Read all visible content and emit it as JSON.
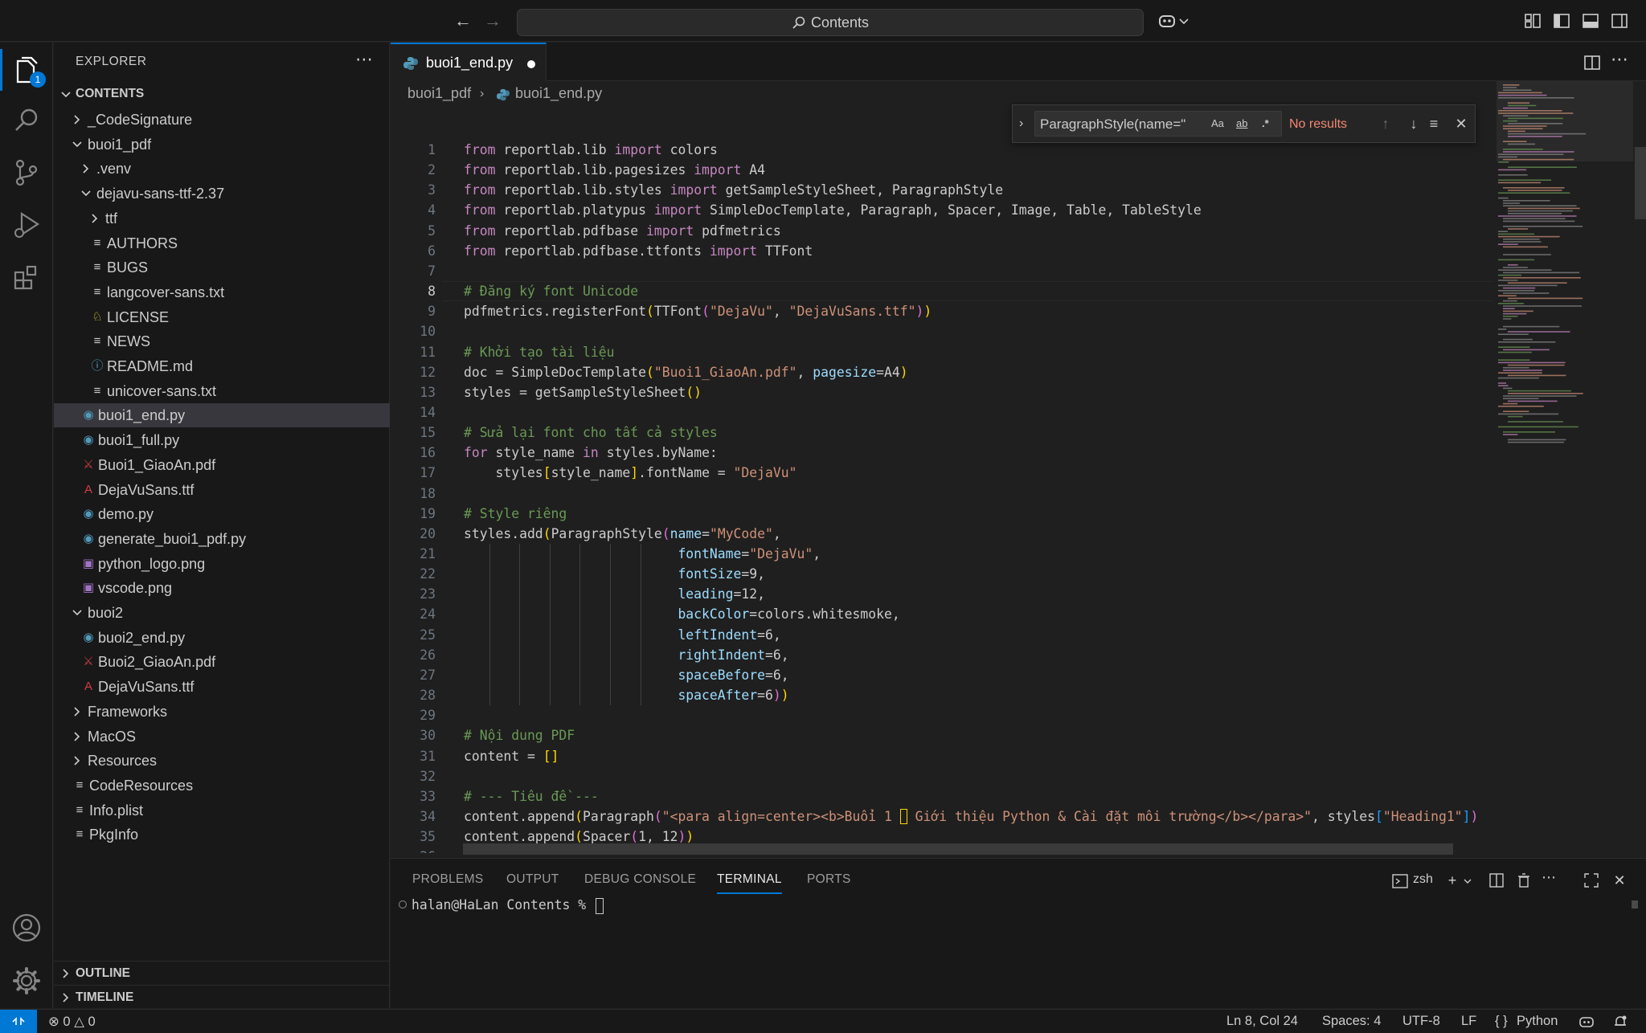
{
  "titlebar": {
    "search_text": "Contents"
  },
  "activity": {
    "explorer_badge": "1"
  },
  "sidebar": {
    "title": "EXPLORER",
    "section": "CONTENTS",
    "tree": [
      {
        "label": "_CodeSignature",
        "depth": 0,
        "type": "folder",
        "open": false
      },
      {
        "label": "buoi1_pdf",
        "depth": 0,
        "type": "folder",
        "open": true
      },
      {
        "label": ".venv",
        "depth": 1,
        "type": "folder",
        "open": false
      },
      {
        "label": "dejavu-sans-ttf-2.37",
        "depth": 1,
        "type": "folder",
        "open": true
      },
      {
        "label": "ttf",
        "depth": 2,
        "type": "folder",
        "open": false
      },
      {
        "label": "AUTHORS",
        "depth": 2,
        "type": "text"
      },
      {
        "label": "BUGS",
        "depth": 2,
        "type": "text"
      },
      {
        "label": "langcover-sans.txt",
        "depth": 2,
        "type": "text"
      },
      {
        "label": "LICENSE",
        "depth": 2,
        "type": "license"
      },
      {
        "label": "NEWS",
        "depth": 2,
        "type": "text"
      },
      {
        "label": "README.md",
        "depth": 2,
        "type": "info"
      },
      {
        "label": "unicover-sans.txt",
        "depth": 2,
        "type": "text"
      },
      {
        "label": "buoi1_end.py",
        "depth": 1,
        "type": "python",
        "selected": true
      },
      {
        "label": "buoi1_full.py",
        "depth": 1,
        "type": "python"
      },
      {
        "label": "Buoi1_GiaoAn.pdf",
        "depth": 1,
        "type": "pdf"
      },
      {
        "label": "DejaVuSans.ttf",
        "depth": 1,
        "type": "font"
      },
      {
        "label": "demo.py",
        "depth": 1,
        "type": "python"
      },
      {
        "label": "generate_buoi1_pdf.py",
        "depth": 1,
        "type": "python"
      },
      {
        "label": "python_logo.png",
        "depth": 1,
        "type": "image"
      },
      {
        "label": "vscode.png",
        "depth": 1,
        "type": "image"
      },
      {
        "label": "buoi2",
        "depth": 0,
        "type": "folder",
        "open": true
      },
      {
        "label": "buoi2_end.py",
        "depth": 1,
        "type": "python"
      },
      {
        "label": "Buoi2_GiaoAn.pdf",
        "depth": 1,
        "type": "pdf"
      },
      {
        "label": "DejaVuSans.ttf",
        "depth": 1,
        "type": "font"
      },
      {
        "label": "Frameworks",
        "depth": 0,
        "type": "folder",
        "open": false
      },
      {
        "label": "MacOS",
        "depth": 0,
        "type": "folder",
        "open": false
      },
      {
        "label": "Resources",
        "depth": 0,
        "type": "folder",
        "open": false
      },
      {
        "label": "CodeResources",
        "depth": 0,
        "type": "text"
      },
      {
        "label": "Info.plist",
        "depth": 0,
        "type": "text"
      },
      {
        "label": "PkgInfo",
        "depth": 0,
        "type": "text"
      }
    ],
    "outline": "OUTLINE",
    "timeline": "TIMELINE"
  },
  "editor": {
    "tab_label": "buoi1_end.py",
    "breadcrumb": [
      "buoi1_pdf",
      "buoi1_end.py"
    ],
    "current_line": 8,
    "find": {
      "value": "ParagraphStyle(name=\"",
      "status": "No results",
      "opt_case": "Aa",
      "opt_word": "ab",
      "opt_regex": ".*"
    },
    "lines": [
      [
        [
          "kw",
          "from"
        ],
        [
          "t",
          " reportlab.lib "
        ],
        [
          "kw",
          "import"
        ],
        [
          "t",
          " colors"
        ]
      ],
      [
        [
          "kw",
          "from"
        ],
        [
          "t",
          " reportlab.lib.pagesizes "
        ],
        [
          "kw",
          "import"
        ],
        [
          "t",
          " A4"
        ]
      ],
      [
        [
          "kw",
          "from"
        ],
        [
          "t",
          " reportlab.lib.styles "
        ],
        [
          "kw",
          "import"
        ],
        [
          "t",
          " getSampleStyleSheet, ParagraphStyle"
        ]
      ],
      [
        [
          "kw",
          "from"
        ],
        [
          "t",
          " reportlab.platypus "
        ],
        [
          "kw",
          "import"
        ],
        [
          "t",
          " SimpleDocTemplate, Paragraph, Spacer, Image, Table, TableStyle"
        ]
      ],
      [
        [
          "kw",
          "from"
        ],
        [
          "t",
          " reportlab.pdfbase "
        ],
        [
          "kw",
          "import"
        ],
        [
          "t",
          " pdfmetrics"
        ]
      ],
      [
        [
          "kw",
          "from"
        ],
        [
          "t",
          " reportlab.pdfbase.ttfonts "
        ],
        [
          "kw",
          "import"
        ],
        [
          "t",
          " TTFont"
        ]
      ],
      [],
      [
        [
          "cmt",
          "# Đăng ký font Unicode"
        ]
      ],
      [
        [
          "t",
          "pdfmetrics.registerFont"
        ],
        [
          "br1",
          "("
        ],
        [
          "t",
          "TTFont"
        ],
        [
          "br2",
          "("
        ],
        [
          "str",
          "\"DejaVu\""
        ],
        [
          "t",
          ", "
        ],
        [
          "str",
          "\"DejaVuSans.ttf\""
        ],
        [
          "br2",
          ")"
        ],
        [
          "br1",
          ")"
        ]
      ],
      [],
      [
        [
          "cmt",
          "# Khởi tạo tài liệu"
        ]
      ],
      [
        [
          "t",
          "doc = SimpleDocTemplate"
        ],
        [
          "br1",
          "("
        ],
        [
          "str",
          "\"Buoi1_GiaoAn.pdf\""
        ],
        [
          "t",
          ", "
        ],
        [
          "param",
          "pagesize"
        ],
        [
          "t",
          "=A4"
        ],
        [
          "br1",
          ")"
        ]
      ],
      [
        [
          "t",
          "styles = getSampleStyleSheet"
        ],
        [
          "br1",
          "()"
        ]
      ],
      [],
      [
        [
          "cmt",
          "# Sửa lại font cho tất cả styles"
        ]
      ],
      [
        [
          "kw",
          "for"
        ],
        [
          "t",
          " style_name "
        ],
        [
          "kw",
          "in"
        ],
        [
          "t",
          " styles.byName:"
        ]
      ],
      [
        [
          "t",
          "    styles"
        ],
        [
          "br1",
          "["
        ],
        [
          "t",
          "style_name"
        ],
        [
          "br1",
          "]"
        ],
        [
          "t",
          ".fontName = "
        ],
        [
          "str",
          "\"DejaVu\""
        ]
      ],
      [],
      [
        [
          "cmt",
          "# Style riêng"
        ]
      ],
      [
        [
          "t",
          "styles.add"
        ],
        [
          "br1",
          "("
        ],
        [
          "t",
          "ParagraphStyle"
        ],
        [
          "br2",
          "("
        ],
        [
          "param",
          "name"
        ],
        [
          "t",
          "="
        ],
        [
          "str",
          "\"MyCode\""
        ],
        [
          "t",
          ","
        ]
      ],
      [
        [
          "t",
          "                           "
        ],
        [
          "param",
          "fontName"
        ],
        [
          "t",
          "="
        ],
        [
          "str",
          "\"DejaVu\""
        ],
        [
          "t",
          ","
        ]
      ],
      [
        [
          "t",
          "                           "
        ],
        [
          "param",
          "fontSize"
        ],
        [
          "t",
          "=9,"
        ]
      ],
      [
        [
          "t",
          "                           "
        ],
        [
          "param",
          "leading"
        ],
        [
          "t",
          "=12,"
        ]
      ],
      [
        [
          "t",
          "                           "
        ],
        [
          "param",
          "backColor"
        ],
        [
          "t",
          "=colors.whitesmoke,"
        ]
      ],
      [
        [
          "t",
          "                           "
        ],
        [
          "param",
          "leftIndent"
        ],
        [
          "t",
          "=6,"
        ]
      ],
      [
        [
          "t",
          "                           "
        ],
        [
          "param",
          "rightIndent"
        ],
        [
          "t",
          "=6,"
        ]
      ],
      [
        [
          "t",
          "                           "
        ],
        [
          "param",
          "spaceBefore"
        ],
        [
          "t",
          "=6,"
        ]
      ],
      [
        [
          "t",
          "                           "
        ],
        [
          "param",
          "spaceAfter"
        ],
        [
          "t",
          "=6"
        ],
        [
          "br2",
          ")"
        ],
        [
          "br1",
          ")"
        ]
      ],
      [],
      [
        [
          "cmt",
          "# Nội dung PDF"
        ]
      ],
      [
        [
          "t",
          "content = "
        ],
        [
          "br1",
          "[]"
        ]
      ],
      [],
      [
        [
          "cmt",
          "# --- Tiêu đề ---"
        ]
      ],
      [
        [
          "t",
          "content.append"
        ],
        [
          "br1",
          "("
        ],
        [
          "t",
          "Paragraph"
        ],
        [
          "br2",
          "("
        ],
        [
          "str",
          "\"<para align=center><b>Buổi 1 "
        ],
        [
          "box",
          " "
        ],
        [
          "str",
          " Giới thiệu Python & Cài đặt môi trường</b></para>\""
        ],
        [
          "t",
          ", styles"
        ],
        [
          "br3",
          "["
        ],
        [
          "str",
          "\"Heading1\""
        ],
        [
          "br3",
          "]"
        ],
        [
          "br2",
          ")"
        ]
      ],
      [
        [
          "t",
          "content.append"
        ],
        [
          "br1",
          "("
        ],
        [
          "t",
          "Spacer"
        ],
        [
          "br2",
          "("
        ],
        [
          "t",
          "1, 12"
        ],
        [
          "br2",
          ")"
        ],
        [
          "br1",
          ")"
        ]
      ],
      []
    ]
  },
  "panel": {
    "tabs": [
      "PROBLEMS",
      "OUTPUT",
      "DEBUG CONSOLE",
      "TERMINAL",
      "PORTS"
    ],
    "active_tab": "TERMINAL",
    "shell": "zsh",
    "terminal_prompt": "halan@HaLan Contents % "
  },
  "statusbar": {
    "errors": "0",
    "warnings": "0",
    "position": "Ln 8, Col 24",
    "spaces": "Spaces: 4",
    "encoding": "UTF-8",
    "eol": "LF",
    "language": "Python"
  },
  "colors": {
    "accent": "#0078d4",
    "background": "#1f1f1f",
    "sidebar": "#181818",
    "error_text": "#f48771"
  }
}
